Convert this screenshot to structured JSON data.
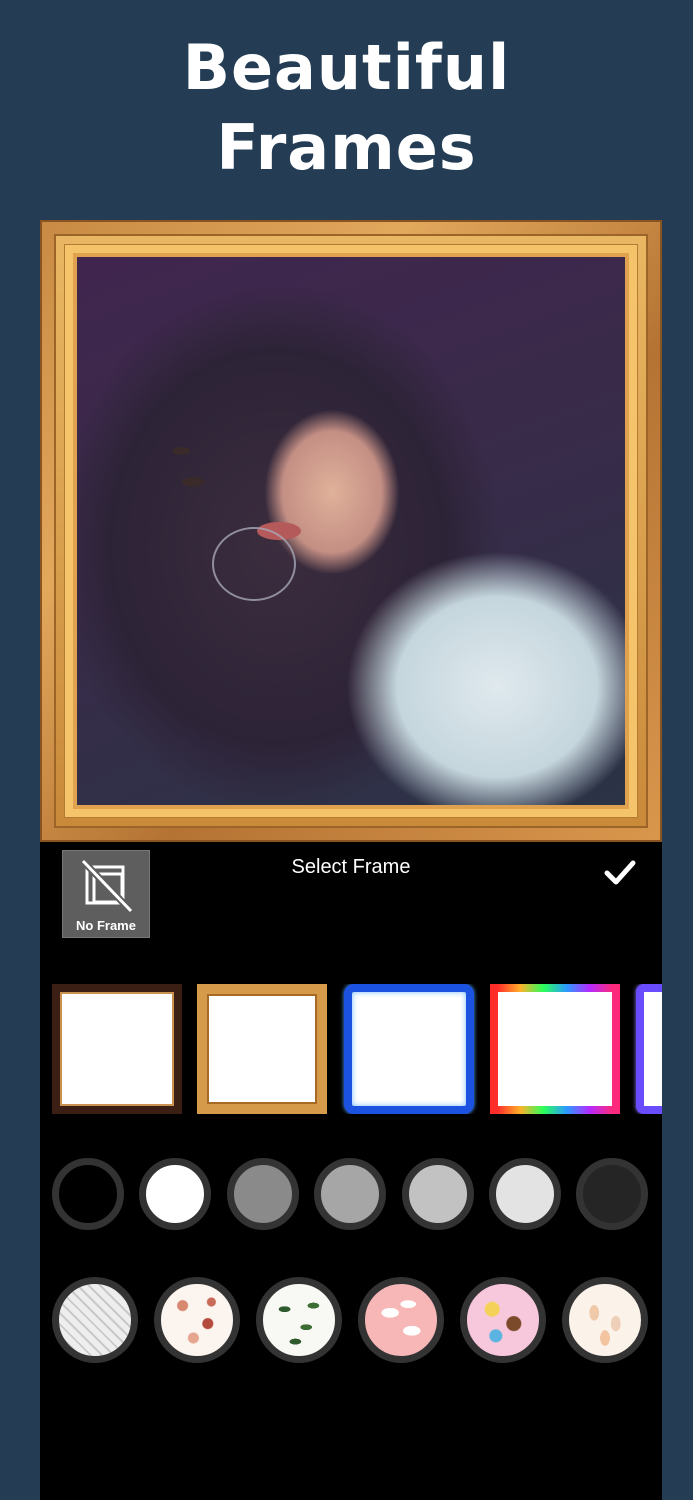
{
  "headline": {
    "line1": "Beautiful",
    "line2": "Frames"
  },
  "panel": {
    "title": "Select Frame",
    "no_frame_label": "No Frame",
    "confirm_icon": "checkmark-icon"
  },
  "frame_thumbnails": [
    {
      "name": "dark-wood-frame"
    },
    {
      "name": "gold-frame"
    },
    {
      "name": "blue-neon-frame"
    },
    {
      "name": "rainbow-neon-frame"
    },
    {
      "name": "purple-neon-frame"
    }
  ],
  "color_swatches": [
    "#000000",
    "#ffffff",
    "#8a8a8a",
    "#a6a6a6",
    "#c2c2c2",
    "#e3e3e3",
    "#252525"
  ],
  "pattern_swatches": [
    "grey-waves",
    "autumn-leaves",
    "green-leaves",
    "pink-clouds",
    "cupcakes",
    "beige-feathers"
  ]
}
